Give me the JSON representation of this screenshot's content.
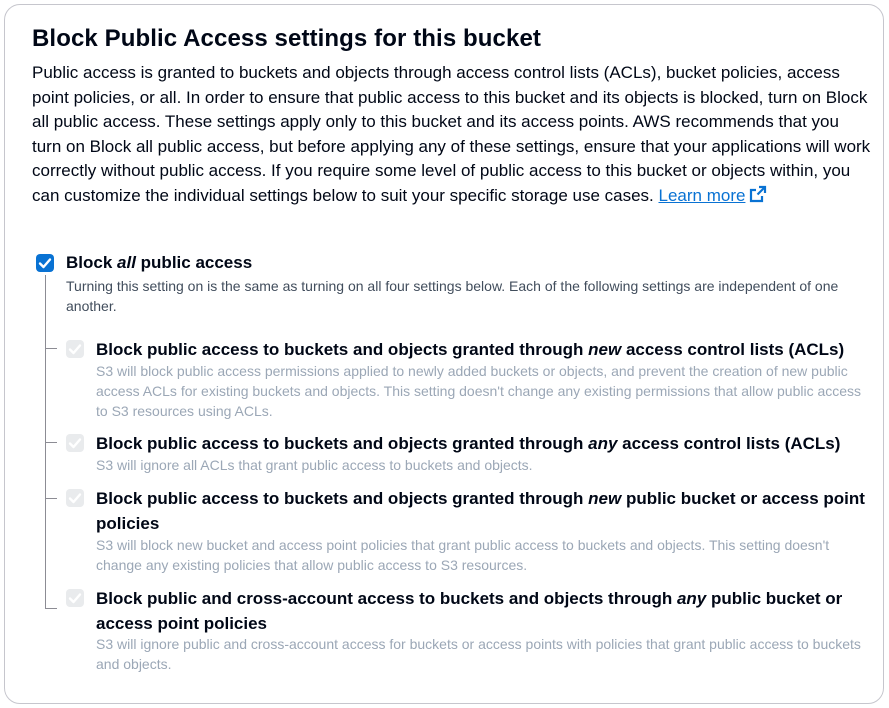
{
  "section": {
    "title": "Block Public Access settings for this bucket",
    "description": "Public access is granted to buckets and objects through access control lists (ACLs), bucket policies, access point policies, or all. In order to ensure that public access to this bucket and its objects is blocked, turn on Block all public access. These settings apply only to this bucket and its access points. AWS recommends that you turn on Block all public access, but before applying any of these settings, ensure that your applications will work correctly without public access. If you require some level of public access to this bucket or objects within, you can customize the individual settings below to suit your specific storage use cases.",
    "learn_more": "Learn more",
    "learn_more_icon": "external-link-icon"
  },
  "block_all": {
    "checked": true,
    "label_prefix": "Block ",
    "label_emphasis": "all",
    "label_suffix": " public access",
    "description": "Turning this setting on is the same as turning on all four settings below. Each of the following settings are independent of one another."
  },
  "options": [
    {
      "checked": true,
      "disabled": true,
      "label_prefix": "Block public access to buckets and objects granted through ",
      "label_emphasis": "new",
      "label_suffix": " access control lists (ACLs)",
      "description": "S3 will block public access permissions applied to newly added buckets or objects, and prevent the creation of new public access ACLs for existing buckets and objects. This setting doesn't change any existing permissions that allow public access to S3 resources using ACLs."
    },
    {
      "checked": true,
      "disabled": true,
      "label_prefix": "Block public access to buckets and objects granted through ",
      "label_emphasis": "any",
      "label_suffix": " access control lists (ACLs)",
      "description": "S3 will ignore all ACLs that grant public access to buckets and objects."
    },
    {
      "checked": true,
      "disabled": true,
      "label_prefix": "Block public access to buckets and objects granted through ",
      "label_emphasis": "new",
      "label_suffix": " public bucket or access point policies",
      "description": "S3 will block new bucket and access point policies that grant public access to buckets and objects. This setting doesn't change any existing policies that allow public access to S3 resources."
    },
    {
      "checked": true,
      "disabled": true,
      "label_prefix": "Block public and cross-account access to buckets and objects through ",
      "label_emphasis": "any",
      "label_suffix": " public bucket or access point policies",
      "description": "S3 will ignore public and cross-account access for buckets or access points with policies that grant public access to buckets and objects."
    }
  ],
  "colors": {
    "accent": "#0972d3",
    "text": "#000716",
    "muted": "#414d5c",
    "disabled_text": "#9ba7b6",
    "disabled_box": "#e9ebed",
    "border": "#c6c6cd"
  }
}
